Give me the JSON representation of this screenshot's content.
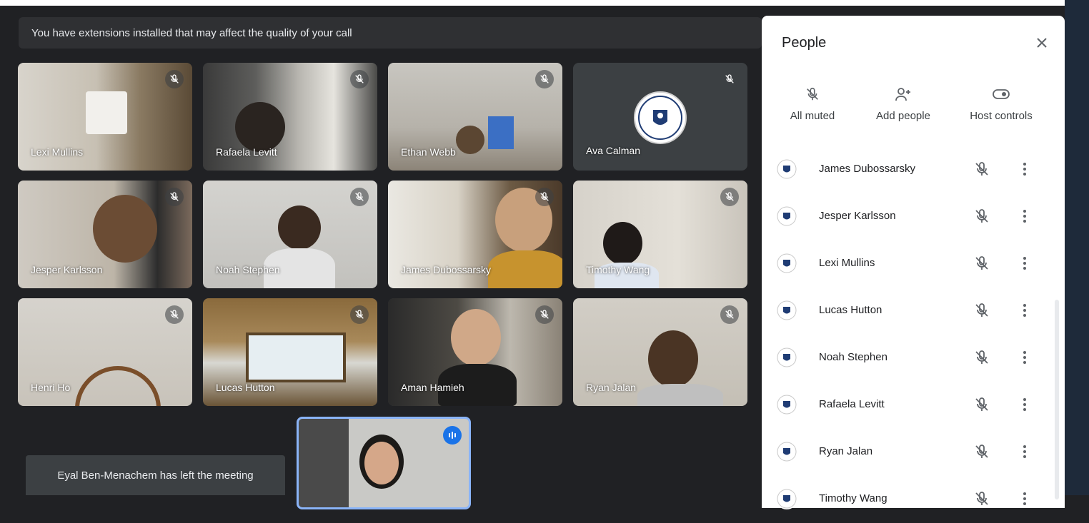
{
  "banner": {
    "text": "You have extensions installed that may affect the quality of your call"
  },
  "tiles": [
    {
      "name": "Lexi Mullins"
    },
    {
      "name": "Rafaela Levitt"
    },
    {
      "name": "Ethan Webb"
    },
    {
      "name": "Ava Calman"
    },
    {
      "name": "Jesper Karlsson"
    },
    {
      "name": "Noah Stephen"
    },
    {
      "name": "James Dubossarsky"
    },
    {
      "name": "Timothy Wang"
    },
    {
      "name": "Henri Ho"
    },
    {
      "name": "Lucas Hutton"
    },
    {
      "name": "Aman Hamieh"
    },
    {
      "name": "Ryan Jalan"
    }
  ],
  "toast": {
    "text": "Eyal Ben-Menachem has left the meeting"
  },
  "panel": {
    "title": "People",
    "actions": [
      {
        "label": "All muted",
        "icon": "mic-off-icon"
      },
      {
        "label": "Add people",
        "icon": "person-add-icon"
      },
      {
        "label": "Host controls",
        "icon": "toggle-icon"
      }
    ],
    "participants": [
      {
        "name": "James Dubossarsky"
      },
      {
        "name": "Jesper Karlsson"
      },
      {
        "name": "Lexi Mullins"
      },
      {
        "name": "Lucas Hutton"
      },
      {
        "name": "Noah Stephen"
      },
      {
        "name": "Rafaela Levitt"
      },
      {
        "name": "Ryan Jalan"
      },
      {
        "name": "Timothy Wang"
      }
    ]
  },
  "colors": {
    "background": "#202124",
    "accent": "#1a73e8",
    "panel": "#ffffff"
  }
}
